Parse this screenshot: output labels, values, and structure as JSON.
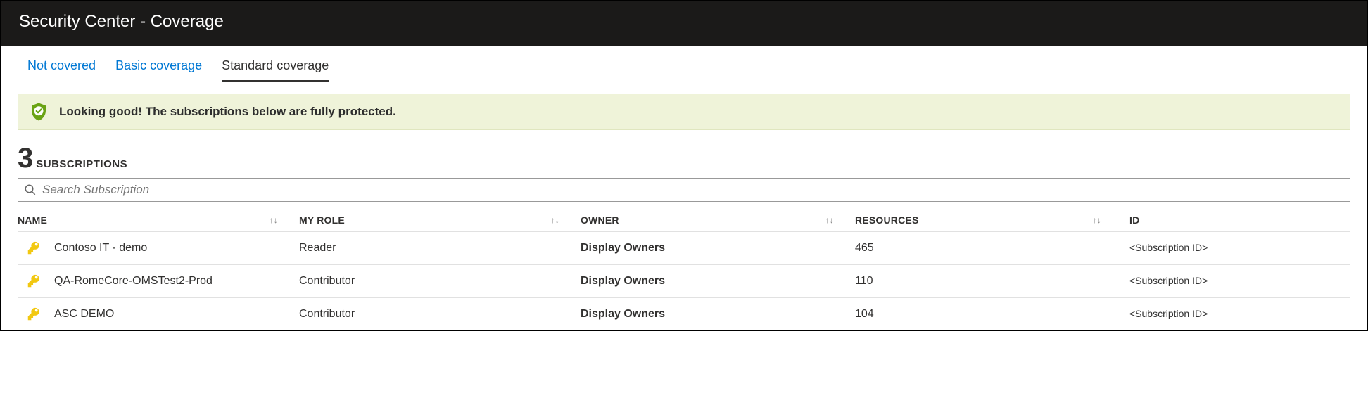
{
  "header": {
    "title": "Security Center - Coverage"
  },
  "tabs": [
    {
      "label": "Not covered",
      "active": false
    },
    {
      "label": "Basic coverage",
      "active": false
    },
    {
      "label": "Standard coverage",
      "active": true
    }
  ],
  "banner": {
    "message": "Looking good! The subscriptions below are fully protected."
  },
  "summary": {
    "count": "3",
    "label": "SUBSCRIPTIONS"
  },
  "search": {
    "placeholder": "Search Subscription"
  },
  "columns": {
    "name": "NAME",
    "role": "MY ROLE",
    "owner": "OWNER",
    "resources": "RESOURCES",
    "id": "ID"
  },
  "rows": [
    {
      "name": "Contoso IT - demo",
      "role": "Reader",
      "owner": "Display Owners",
      "resources": "465",
      "id": "<Subscription ID>"
    },
    {
      "name": "QA-RomeCore-OMSTest2-Prod",
      "role": "Contributor",
      "owner": "Display Owners",
      "resources": "110",
      "id": "<Subscription ID>"
    },
    {
      "name": "ASC DEMO",
      "role": "Contributor",
      "owner": "Display Owners",
      "resources": "104",
      "id": "<Subscription ID>"
    }
  ]
}
